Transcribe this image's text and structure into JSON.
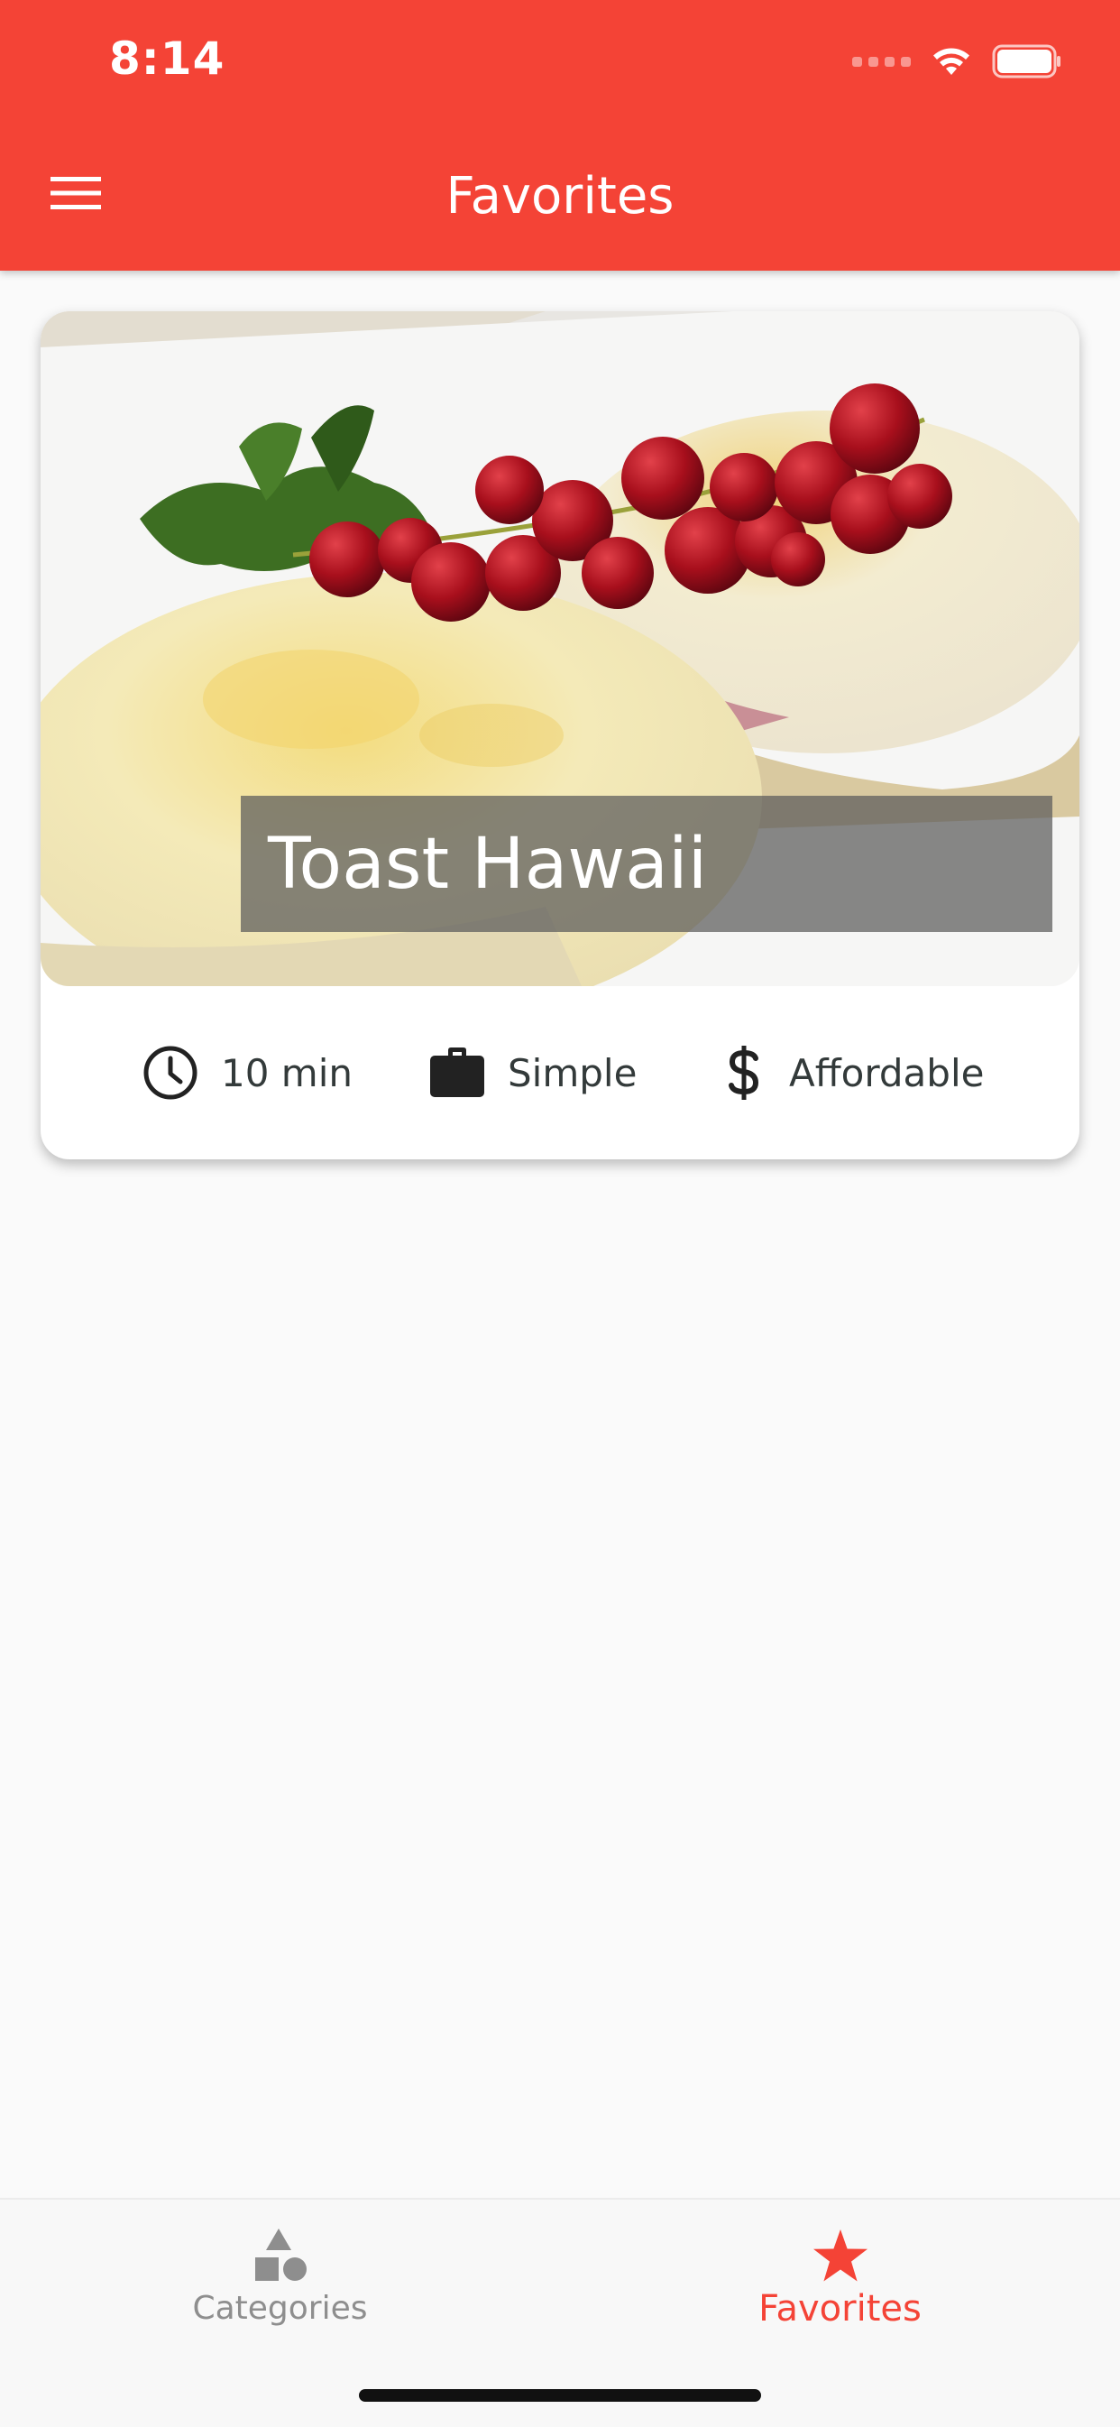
{
  "status_bar": {
    "time": "8:14"
  },
  "header": {
    "title": "Favorites",
    "menu_icon": "hamburger-menu-icon",
    "background": "#f44336"
  },
  "favorites": [
    {
      "title": "Toast Hawaii",
      "duration": "10 min",
      "complexity": "Simple",
      "affordability": "Affordable",
      "icons": {
        "duration": "clock-icon",
        "complexity": "briefcase-icon",
        "affordability": "dollar-sign-icon"
      }
    }
  ],
  "bottom_nav": {
    "tabs": [
      {
        "label": "Categories",
        "icon": "categories-shapes-icon",
        "active": false
      },
      {
        "label": "Favorites",
        "icon": "star-icon",
        "active": true
      }
    ],
    "active_color": "#f44336",
    "inactive_color": "#8e8e8e"
  }
}
